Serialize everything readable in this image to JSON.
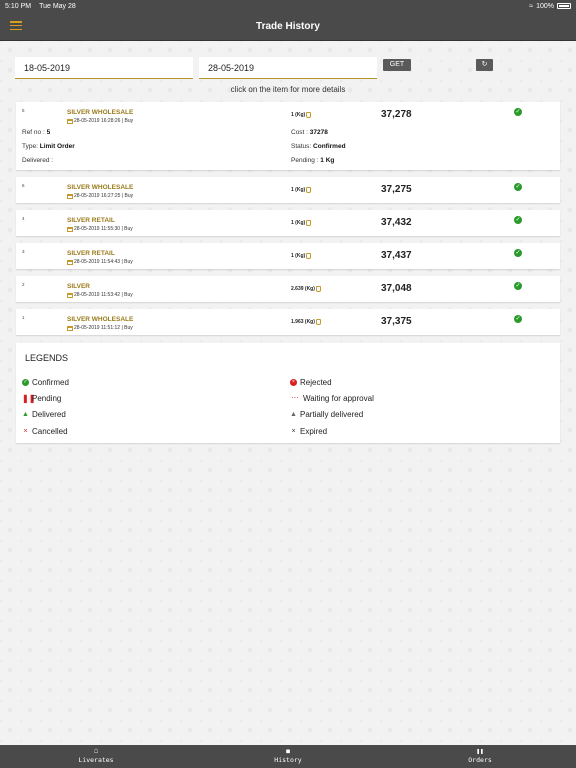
{
  "status": {
    "time": "5:10 PM",
    "date": "Tue May 28",
    "battery": "100%"
  },
  "header": {
    "title": "Trade History"
  },
  "filters": {
    "from_date": "18-05-2019",
    "to_date": "28-05-2019",
    "get_label": "GET",
    "refresh_icon": "refresh-icon"
  },
  "hint": "click on the item for more details",
  "trades": [
    {
      "index": "5",
      "product": "SILVER WHOLESALE",
      "meta": "28-05-2019 16:28:26 | Buy",
      "qty": "1 (Kg)",
      "price": "37,278",
      "status_icon": "check-circle-icon"
    },
    {
      "index": "6",
      "product": "SILVER WHOLESALE",
      "meta": "28-05-2019 16:27:25 | Buy",
      "qty": "1 (Kg)",
      "price": "37,275",
      "status_icon": "check-circle-icon"
    },
    {
      "index": "4",
      "product": "SILVER RETAIL",
      "meta": "28-05-2019 11:55:30 | Buy",
      "qty": "1 (Kg)",
      "price": "37,432",
      "status_icon": "check-circle-icon"
    },
    {
      "index": "3",
      "product": "SILVER RETAIL",
      "meta": "28-05-2019 11:54:43 | Buy",
      "qty": "1 (Kg)",
      "price": "37,437",
      "status_icon": "check-circle-icon"
    },
    {
      "index": "2",
      "product": "SILVER",
      "meta": "28-05-2019 11:53:42 | Buy",
      "qty": "2.639 (Kg)",
      "price": "37,048",
      "status_icon": "check-circle-icon"
    },
    {
      "index": "1",
      "product": "SILVER WHOLESALE",
      "meta": "28-05-2019 11:51:12 | Buy",
      "qty": "1.963 (Kg)",
      "price": "37,375",
      "status_icon": "check-circle-icon"
    }
  ],
  "expanded": {
    "ref_label": "Ref no : ",
    "ref_value": "5",
    "type_label": "Type: ",
    "type_value": "Limit Order",
    "delivered_label": "Delivered :",
    "cost_label": "Cost : ",
    "cost_value": "37278",
    "status_label": "Status: ",
    "status_value": "Confirmed",
    "pending_label": "Pending : ",
    "pending_value": "1 Kg"
  },
  "legends": {
    "title": "LEGENDS",
    "items": [
      {
        "label": "Confirmed",
        "icon": "check-circle-icon"
      },
      {
        "label": "Rejected",
        "icon": "x-circle-icon"
      },
      {
        "label": "Pending",
        "icon": "pause-icon"
      },
      {
        "label": "Waiting for approval",
        "icon": "ellipsis-icon"
      },
      {
        "label": "Delivered",
        "icon": "thumbs-up-icon"
      },
      {
        "label": "Partially delivered",
        "icon": "thumbs-up-grey-icon"
      },
      {
        "label": "Cancelled",
        "icon": "cross-icon"
      },
      {
        "label": "Expired",
        "icon": "cross-small-icon"
      }
    ]
  },
  "tabs": [
    {
      "label": "Liverates",
      "icon": "home-icon"
    },
    {
      "label": "History",
      "icon": "history-icon"
    },
    {
      "label": "Orders",
      "icon": "orders-icon"
    }
  ],
  "colors": {
    "bar": "#4a4a4a",
    "accent": "#9a7a1a",
    "confirmed": "#2a9a2a",
    "rejected": "#d82020"
  }
}
